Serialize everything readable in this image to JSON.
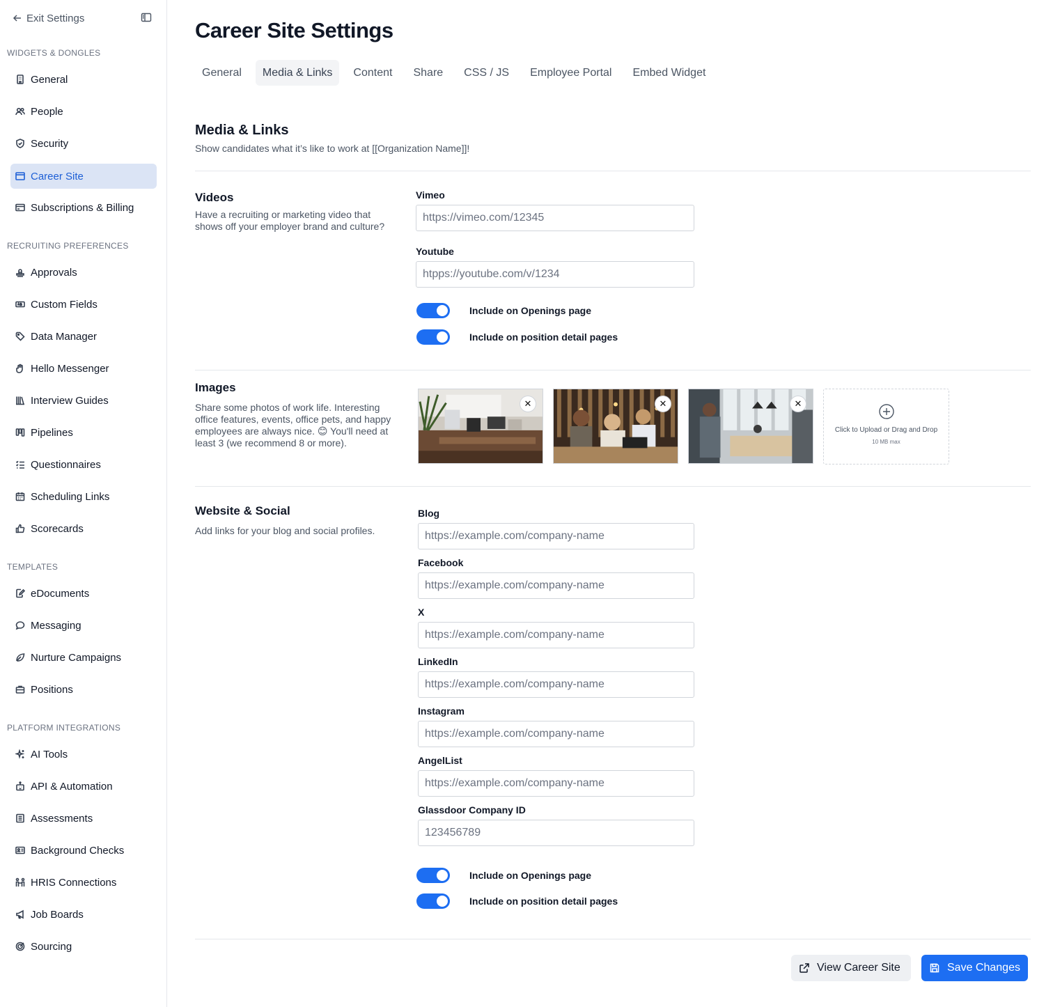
{
  "sidebar": {
    "exit_label": "Exit Settings",
    "sections": {
      "widgets": "WIDGETS & DONGLES",
      "recruiting": "RECRUITING PREFERENCES",
      "templates": "TEMPLATES",
      "integrations": "PLATFORM INTEGRATIONS"
    },
    "items": {
      "general": "General",
      "people": "People",
      "security": "Security",
      "career_site": "Career Site",
      "billing": "Subscriptions & Billing",
      "approvals": "Approvals",
      "custom_fields": "Custom Fields",
      "data_manager": "Data Manager",
      "hello_messenger": "Hello Messenger",
      "interview_guides": "Interview Guides",
      "pipelines": "Pipelines",
      "questionnaires": "Questionnaires",
      "scheduling_links": "Scheduling Links",
      "scorecards": "Scorecards",
      "edocuments": "eDocuments",
      "messaging": "Messaging",
      "nurture_campaigns": "Nurture Campaigns",
      "positions": "Positions",
      "ai_tools": "AI Tools",
      "api_automation": "API & Automation",
      "assessments": "Assessments",
      "background_checks": "Background Checks",
      "hris_connections": "HRIS Connections",
      "job_boards": "Job Boards",
      "sourcing": "Sourcing"
    }
  },
  "header": {
    "title": "Career Site Settings",
    "tabs": [
      "General",
      "Media & Links",
      "Content",
      "Share",
      "CSS / JS",
      "Employee Portal",
      "Embed Widget"
    ]
  },
  "section": {
    "title": "Media & Links",
    "subtitle": "Show candidates what it’s like to work at [[Organization Name]]!"
  },
  "videos": {
    "title": "Videos",
    "description": "Have a recruiting or marketing video that shows off your employer brand and culture?",
    "vimeo_label": "Vimeo",
    "vimeo_placeholder": "https://vimeo.com/12345",
    "youtube_label": "Youtube",
    "youtube_placeholder": "htpps://youtube.com/v/1234",
    "toggle_openings": "Include on Openings page",
    "toggle_detail": "Include on position detail pages"
  },
  "images": {
    "title": "Images",
    "description": "Share some photos of work life. Interesting office features, events, office pets, and happy employees are always nice. 😊 You'll need at least 3 (we recommend 8 or more).",
    "remove_glyph": "✕",
    "upload_label": "Click to Upload or Drag and Drop",
    "upload_limit": "10 MB max"
  },
  "social": {
    "title": "Website & Social",
    "description": "Add links for your blog and social profiles.",
    "placeholder": "https://example.com/company-name",
    "blog_label": "Blog",
    "facebook_label": "Facebook",
    "x_label": "X",
    "linkedin_label": "LinkedIn",
    "instagram_label": "Instagram",
    "angellist_label": "AngelList",
    "glassdoor_label": "Glassdoor Company ID",
    "glassdoor_placeholder": "123456789",
    "toggle_openings": "Include on Openings page",
    "toggle_detail": "Include on position detail pages"
  },
  "footer": {
    "view_label": "View Career Site",
    "save_label": "Save Changes"
  },
  "colors": {
    "accent": "#1d6ef2",
    "active_nav_bg": "#dbe4f5",
    "active_nav_text": "#1d5fd6"
  }
}
